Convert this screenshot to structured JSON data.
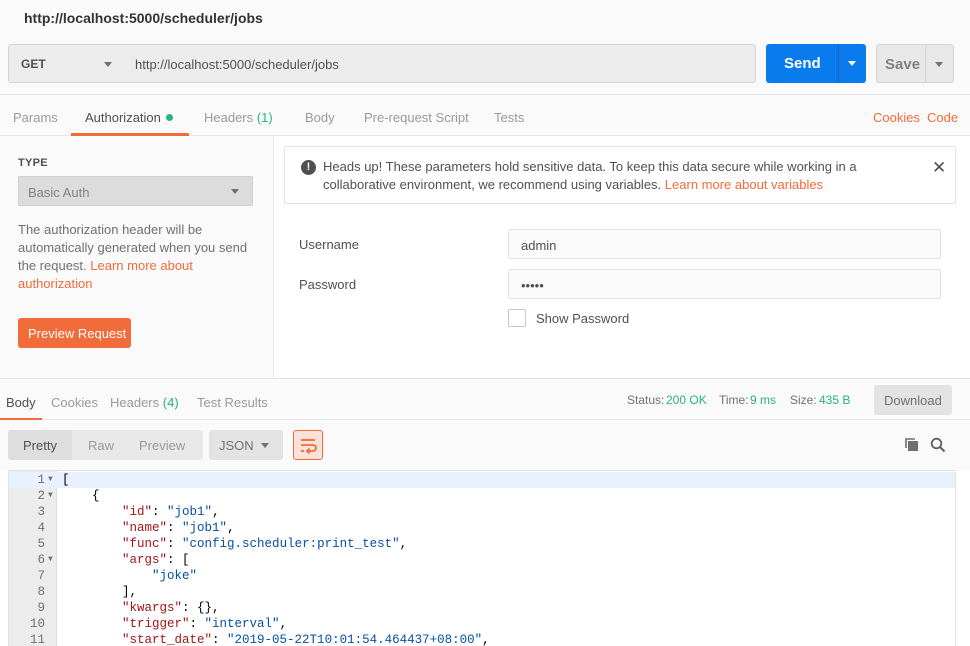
{
  "window": {
    "title": "http://localhost:5000/scheduler/jobs"
  },
  "request": {
    "method": "GET",
    "url": "http://localhost:5000/scheduler/jobs",
    "send_label": "Send",
    "save_label": "Save"
  },
  "tabs": {
    "params": "Params",
    "authorization": "Authorization",
    "headers": "Headers",
    "headers_count": "(1)",
    "body": "Body",
    "prerequest": "Pre-request Script",
    "tests": "Tests",
    "cookies": "Cookies",
    "code": "Code"
  },
  "auth": {
    "type_label": "TYPE",
    "type_value": "Basic Auth",
    "description": "The authorization header will be automatically generated when you send the request.",
    "learn_more": "Learn more about authorization",
    "preview_button": "Preview Request",
    "alert_text": "Heads up! These parameters hold sensitive data. To keep this data secure while working in a collaborative environment, we recommend using variables.",
    "alert_link": "Learn more about variables",
    "username_label": "Username",
    "username_value": "admin",
    "password_label": "Password",
    "password_value": "•••••",
    "show_password_label": "Show Password"
  },
  "response": {
    "tabs": {
      "body": "Body",
      "cookies": "Cookies",
      "headers": "Headers",
      "headers_count": "(4)",
      "test_results": "Test Results"
    },
    "status_label": "Status:",
    "status_value": "200 OK",
    "time_label": "Time:",
    "time_value": "9 ms",
    "size_label": "Size:",
    "size_value": "435 B",
    "download_label": "Download",
    "view_modes": [
      "Pretty",
      "Raw",
      "Preview"
    ],
    "format": "JSON"
  },
  "code_lines": [
    {
      "n": "1",
      "fold": true,
      "text": "["
    },
    {
      "n": "2",
      "fold": true,
      "text": "    {"
    },
    {
      "n": "3",
      "fold": false,
      "key": "\"id\"",
      "val": "\"job1\"",
      "tail": ","
    },
    {
      "n": "4",
      "fold": false,
      "key": "\"name\"",
      "val": "\"job1\"",
      "tail": ","
    },
    {
      "n": "5",
      "fold": false,
      "key": "\"func\"",
      "val": "\"config.scheduler:print_test\"",
      "tail": ","
    },
    {
      "n": "6",
      "fold": true,
      "key": "\"args\"",
      "val": "",
      "tail": "["
    },
    {
      "n": "7",
      "fold": false,
      "text": "            ",
      "val": "\"joke\""
    },
    {
      "n": "8",
      "fold": false,
      "text": "        ],"
    },
    {
      "n": "9",
      "fold": false,
      "key": "\"kwargs\"",
      "val": "",
      "tail": "{},"
    },
    {
      "n": "10",
      "fold": false,
      "key": "\"trigger\"",
      "val": "\"interval\"",
      "tail": ","
    },
    {
      "n": "11",
      "fold": false,
      "key": "\"start_date\"",
      "val": "\"2019-05-22T10:01:54.464437+08:00\"",
      "tail": ","
    }
  ]
}
